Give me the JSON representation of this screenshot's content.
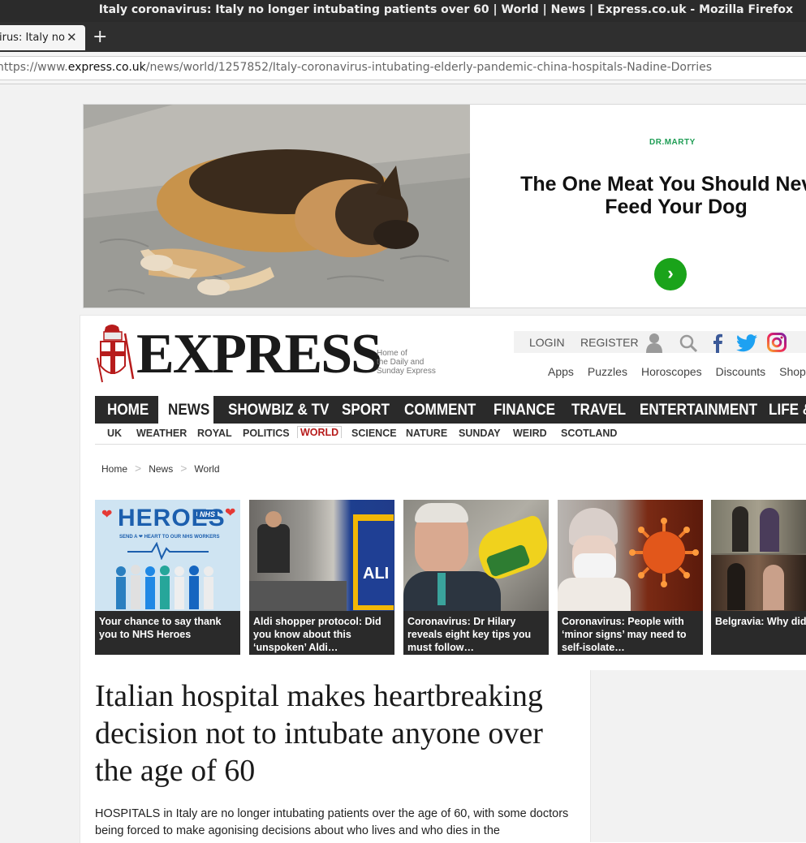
{
  "window": {
    "title": "Italy coronavirus: Italy no longer intubating patients over 60 | World | News | Express.co.uk - Mozilla Firefox"
  },
  "tab": {
    "title": "Italy coronavirus: Italy no",
    "close_glyph": "✕",
    "new_tab_glyph": "+"
  },
  "address_bar": {
    "prefix": "https://www.",
    "domain": "express.co.uk",
    "path": "/news/world/1257852/Italy-coronavirus-intubating-elderly-pandemic-china-hospitals-Nadine-Dorries"
  },
  "ad": {
    "brand": "DR.MARTY",
    "headline": "The One Meat You Should Never\nFeed Your Dog",
    "cta_glyph": "›",
    "colors": {
      "cta": "#1aa31a",
      "brand": "#1f9d55"
    }
  },
  "masthead": {
    "logo_text": "EXPRESS",
    "tagline": "Home of\nthe Daily and\nSunday Express",
    "login_label": "LOGIN",
    "register_label": "REGISTER",
    "icons": [
      "user-icon",
      "search-icon",
      "facebook-icon",
      "twitter-icon",
      "instagram-icon"
    ],
    "quick_links": [
      "Apps",
      "Puzzles",
      "Horoscopes",
      "Discounts",
      "Shop"
    ]
  },
  "main_nav": {
    "items": [
      "HOME",
      "NEWS",
      "SHOWBIZ & TV",
      "SPORT",
      "COMMENT",
      "FINANCE",
      "TRAVEL",
      "ENTERTAINMENT",
      "LIFE &"
    ],
    "active": "NEWS"
  },
  "sub_nav": {
    "items": [
      "UK",
      "WEATHER",
      "ROYAL",
      "POLITICS",
      "WORLD",
      "SCIENCE",
      "NATURE",
      "SUNDAY",
      "WEIRD",
      "SCOTLAND"
    ],
    "active": "WORLD",
    "colors": {
      "active": "#b71c1c"
    }
  },
  "breadcrumb": [
    "Home",
    "News",
    "World"
  ],
  "trending": [
    {
      "caption": "Your chance to say thank you to NHS Heroes",
      "image_text": "HEROES",
      "image_badge": "NHS",
      "image_sub": "SEND A ❤ HEART TO OUR NHS WORKERS"
    },
    {
      "caption": "Aldi shopper protocol: Did you know about this ‘unspoken’ Aldi…",
      "image_text": "ALI"
    },
    {
      "caption": "Coronavirus: Dr Hilary reveals eight key tips you must follow…"
    },
    {
      "caption": "Coronavirus: People with ‘minor signs’ may need to self-isolate…"
    },
    {
      "caption": "Belgravia: Why did Trenchard reveal his family secret? Star…"
    }
  ],
  "article": {
    "headline": "Italian hospital makes heartbreaking decision not to intubate anyone over the age of 60",
    "body": "HOSPITALS in Italy are no longer intubating patients over the age of 60, with some doctors being forced to make agonising decisions about who lives and who dies in the"
  }
}
